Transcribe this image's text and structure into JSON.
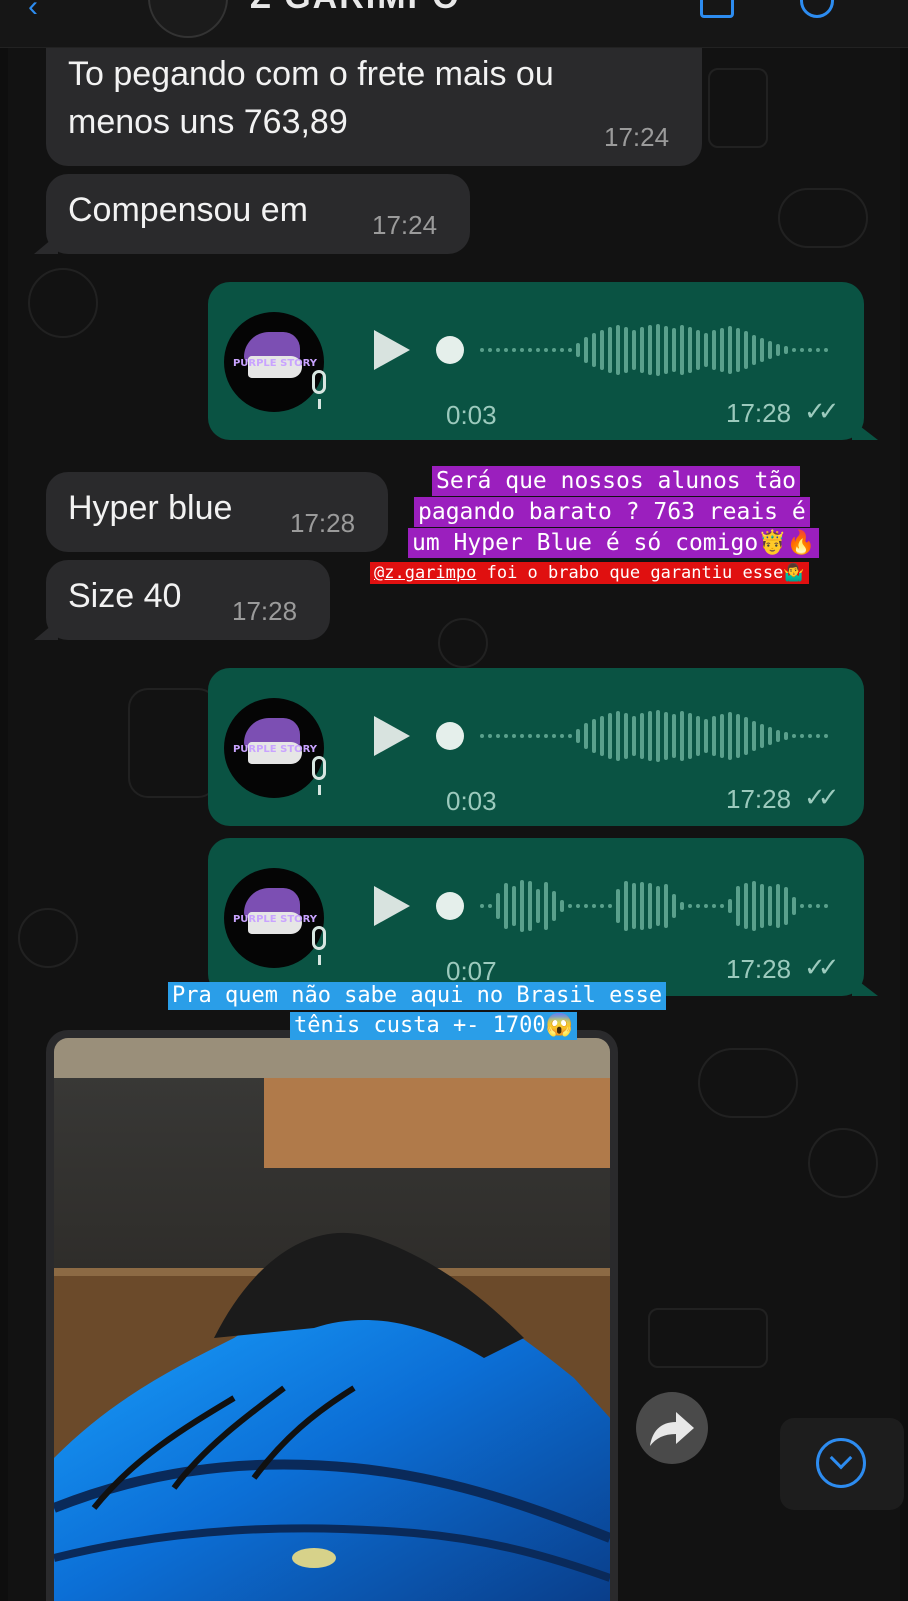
{
  "header": {
    "title": "Z GARIMPO"
  },
  "messages": [
    {
      "type": "text",
      "text_line1": "To pegando com o frete mais ou",
      "text_line2": "menos uns 763,89",
      "time": "17:24"
    },
    {
      "type": "text",
      "text": "Compensou em",
      "time": "17:24"
    },
    {
      "type": "voice",
      "duration": "0:03",
      "time": "17:28",
      "status": "read"
    },
    {
      "type": "text",
      "text": "Hyper blue",
      "time": "17:28"
    },
    {
      "type": "text",
      "text": "Size 40",
      "time": "17:28"
    },
    {
      "type": "voice",
      "duration": "0:03",
      "time": "17:28",
      "status": "read"
    },
    {
      "type": "voice",
      "duration": "0:07",
      "time": "17:28",
      "status": "read"
    },
    {
      "type": "image",
      "subject": "blue sneaker photo"
    }
  ],
  "voice_avatar_brand": "PURPLE STORY",
  "story_captions": {
    "purple_line1": "Será que nossos alunos tão",
    "purple_line2": "pagando barato ? 763 reais é",
    "purple_line3": "um Hyper Blue é só comigo🤴🔥",
    "red_mention": "@z.garimpo",
    "red_rest": " foi o brabo que garantiu esse🤷‍♂️",
    "blue_line1": "Pra quem não sabe aqui no Brasil esse",
    "blue_line2": "tênis custa +- 1700😱"
  },
  "icons": [
    "back-icon",
    "video-call-icon",
    "phone-icon",
    "play-icon",
    "mic-icon",
    "double-check-icon",
    "forward-icon",
    "scroll-down-icon"
  ],
  "colors": {
    "outgoing": "#0a5343",
    "incoming": "#2a2a2c",
    "accent": "#2d8cf0",
    "caption_purple": "#9b1fbe",
    "caption_red": "#e01010",
    "caption_blue": "#2a9ee8"
  }
}
